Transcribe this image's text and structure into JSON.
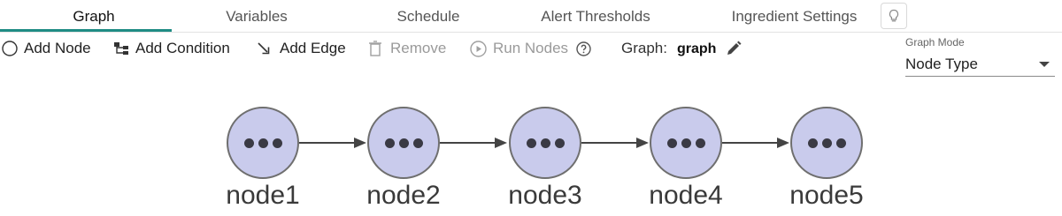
{
  "tabs": [
    {
      "label": "Graph"
    },
    {
      "label": "Variables"
    },
    {
      "label": "Schedule"
    },
    {
      "label": "Alert Thresholds"
    },
    {
      "label": "Ingredient Settings"
    }
  ],
  "toolbar": {
    "add_node": "Add Node",
    "add_condition": "Add Condition",
    "add_edge": "Add Edge",
    "remove": "Remove",
    "run_nodes": "Run Nodes"
  },
  "graph": {
    "label": "Graph:",
    "name": "graph"
  },
  "graph_mode": {
    "label": "Graph Mode",
    "value": "Node Type"
  },
  "nodes": [
    {
      "label": "node1"
    },
    {
      "label": "node2"
    },
    {
      "label": "node3"
    },
    {
      "label": "node4"
    },
    {
      "label": "node5"
    }
  ],
  "colors": {
    "accent": "#1f8c84",
    "node_fill": "#c9cbec",
    "node_stroke": "#6f6f6f"
  }
}
